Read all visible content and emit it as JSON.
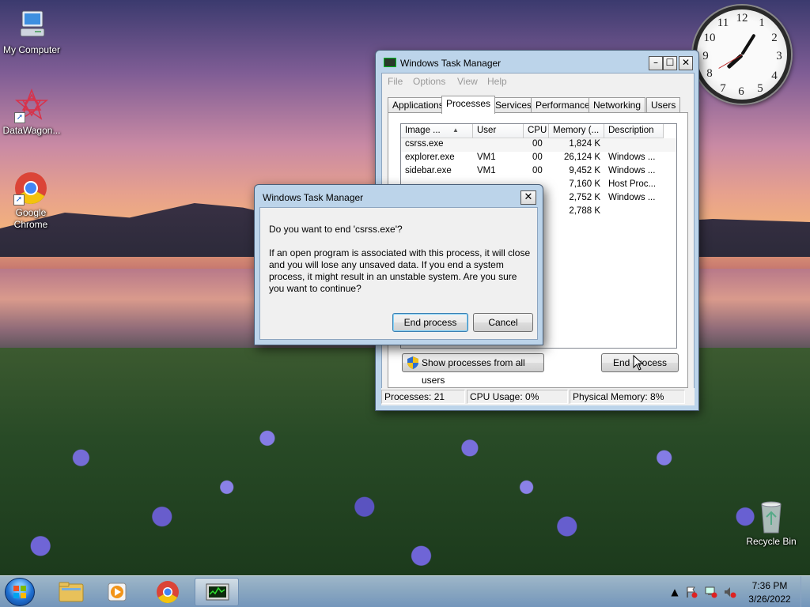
{
  "desktop": {
    "icons": [
      {
        "label": "My Computer"
      },
      {
        "label": "DataWagon..."
      },
      {
        "label": "Google Chrome"
      },
      {
        "label": "Recycle Bin"
      }
    ]
  },
  "clock": {
    "numbers": [
      "12",
      "1",
      "2",
      "3",
      "4",
      "5",
      "6",
      "7",
      "8",
      "9",
      "10",
      "11"
    ]
  },
  "task_manager": {
    "title": "Windows Task Manager",
    "menu": [
      "File",
      "Options",
      "View",
      "Help"
    ],
    "tabs": [
      "Applications",
      "Processes",
      "Services",
      "Performance",
      "Networking",
      "Users"
    ],
    "active_tab": "Processes",
    "columns": [
      "Image ...",
      "User Name",
      "CPU",
      "Memory (...",
      "Description"
    ],
    "rows": [
      {
        "image": "csrss.exe",
        "user": "",
        "cpu": "00",
        "memory": "1,824 K",
        "description": ""
      },
      {
        "image": "explorer.exe",
        "user": "VM1",
        "cpu": "00",
        "memory": "26,124 K",
        "description": "Windows ..."
      },
      {
        "image": "sidebar.exe",
        "user": "VM1",
        "cpu": "00",
        "memory": "9,452 K",
        "description": "Windows ..."
      },
      {
        "image": "",
        "user": "",
        "cpu": "",
        "memory": "7,160 K",
        "description": "Host Proc..."
      },
      {
        "image": "",
        "user": "",
        "cpu": "",
        "memory": "2,752 K",
        "description": "Windows ..."
      },
      {
        "image": "",
        "user": "",
        "cpu": "",
        "memory": "2,788 K",
        "description": ""
      }
    ],
    "show_all_label": "Show processes from all users",
    "end_process_label": "End Process",
    "status": {
      "processes": "Processes: 21",
      "cpu": "CPU Usage: 0%",
      "memory": "Physical Memory: 8%"
    }
  },
  "dialog": {
    "title": "Windows Task Manager",
    "question": "Do you want to end 'csrss.exe'?",
    "body": "If an open program is associated with this process, it will close and you will lose any unsaved data. If you end a system process, it might result in an unstable system. Are you sure you want to continue?",
    "confirm_label": "End process",
    "cancel_label": "Cancel",
    "close_symbol": "✕"
  },
  "taskbar": {
    "time": "7:36 PM",
    "date": "3/26/2022",
    "pinned": [
      "windows-explorer",
      "media-player",
      "google-chrome",
      "task-manager"
    ]
  }
}
